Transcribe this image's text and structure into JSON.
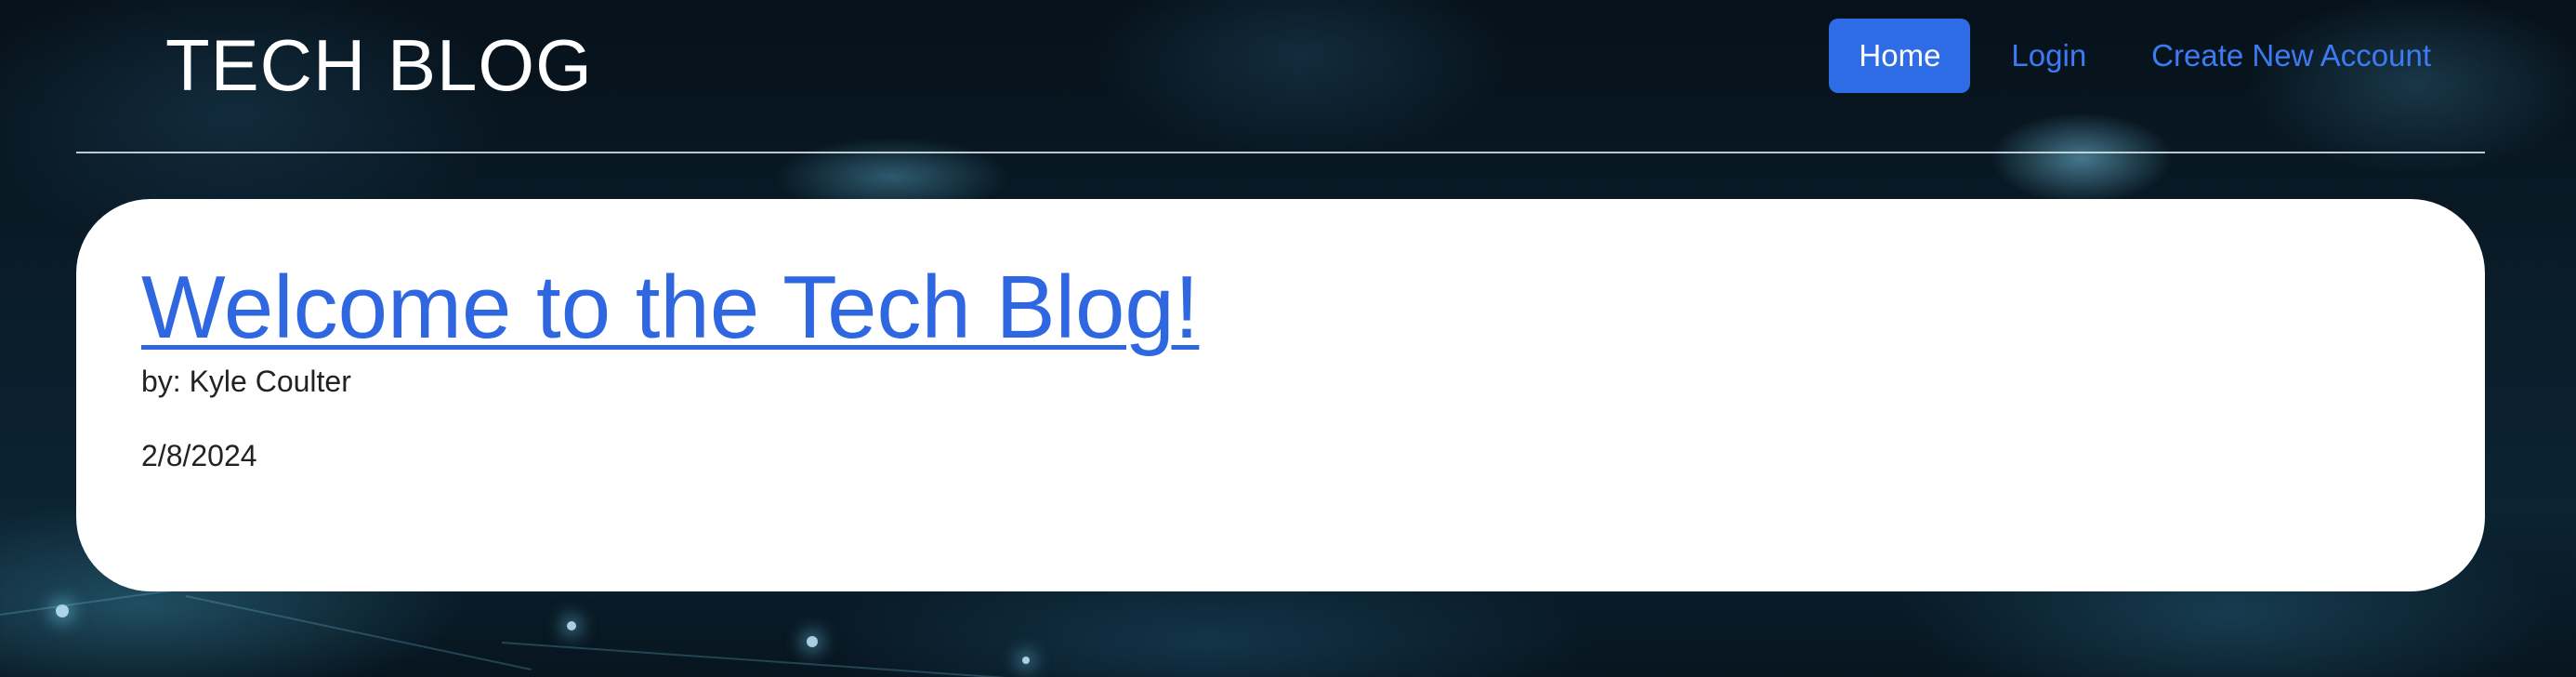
{
  "header": {
    "brand": "TECH BLOG",
    "nav": {
      "home": "Home",
      "login": "Login",
      "create_account": "Create New Account"
    },
    "active_nav": "home"
  },
  "post": {
    "title": "Welcome to the Tech Blog!",
    "author": "by: Kyle Coulter",
    "date": "2/8/2024"
  },
  "colors": {
    "accent": "#2f6de6",
    "link": "#3d7bf5",
    "card_background": "#ffffff",
    "page_background": "#0a1d2a"
  }
}
